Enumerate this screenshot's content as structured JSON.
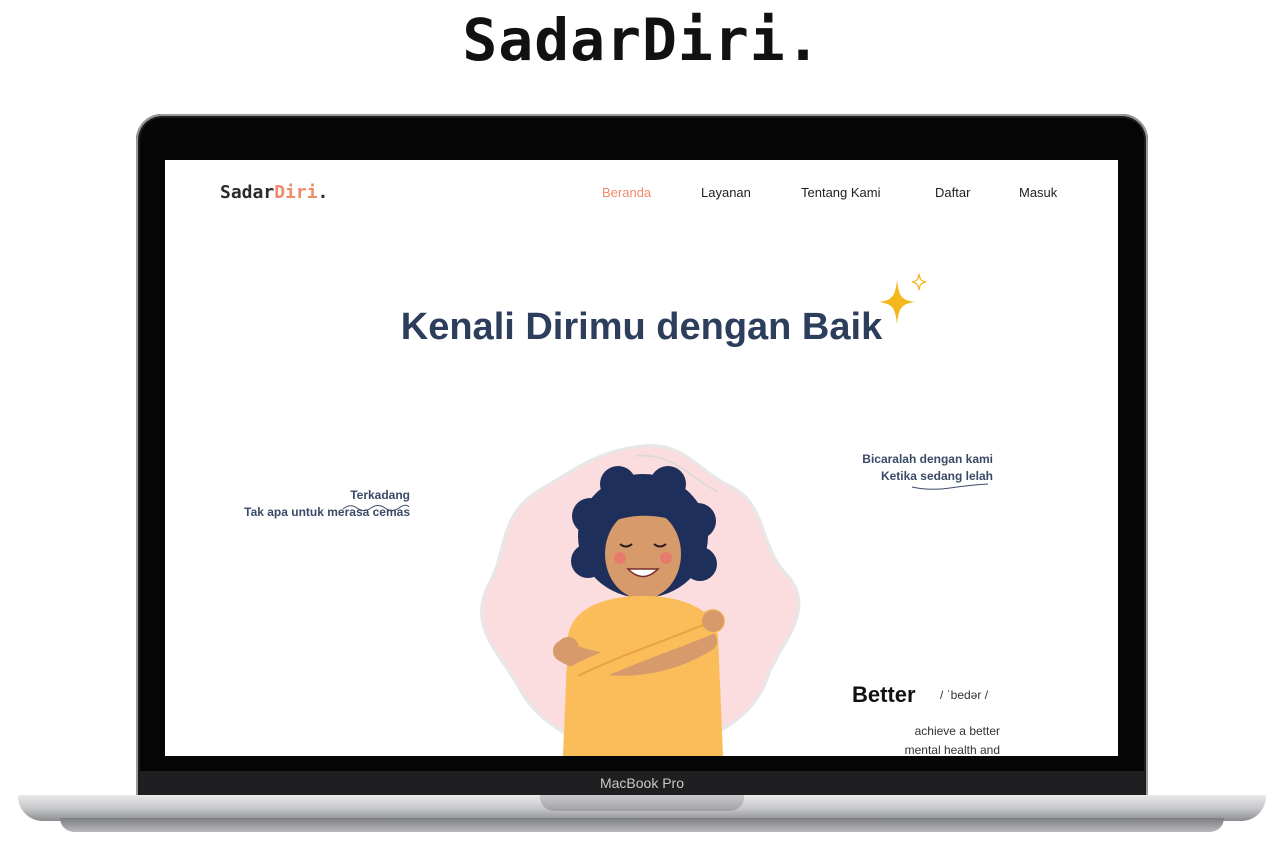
{
  "headline": "SadarDiri.",
  "device_label": "MacBook Pro",
  "site": {
    "logo_main": "Sadar",
    "logo_accent": "Diri",
    "logo_dot": ".",
    "nav": [
      "Beranda",
      "Layanan",
      "Tentang Kami",
      "Daftar",
      "Masuk"
    ],
    "active_nav": "Beranda",
    "hero_title": "Kenali Dirimu dengan Baik",
    "left_note": {
      "line1": "Terkadang",
      "line2": "Tak apa untuk merasa cemas"
    },
    "right_note": {
      "line1": "Bicaralah dengan kami",
      "line2": "Ketika sedang lelah"
    },
    "better_word": "Better",
    "better_phonetic": "/ ˈbedər /",
    "better_desc_line1": "achieve a better",
    "better_desc_line2": "mental health and"
  },
  "colors": {
    "accent": "#f08a6a",
    "title": "#2c3e5c",
    "blob": "#fbdde0",
    "sweater": "#fbbd5a",
    "sparkle": "#f5b81c"
  }
}
